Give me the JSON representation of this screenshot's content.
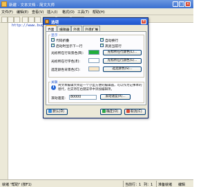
{
  "window": {
    "title": "新建 - 文本文档 - 简文大师",
    "min_glyph": "_",
    "max_glyph": "□",
    "close_glyph": "×"
  },
  "menu": [
    "文件(F)",
    "编辑(E)",
    "查看(V)",
    "插入(I)",
    "格式(O)",
    "工具(T)",
    "帮助(H)"
  ],
  "editor": {
    "first_line": "http://www.buggou.com"
  },
  "status": {
    "left_text": "就绪 \"帮助\" (按F1)",
    "line_text": "当前行：1",
    "col_text": "列：1",
    "mode_text": "准备就绪",
    "ovr_text": "编辑"
  },
  "dialog": {
    "title": "选项",
    "close_glyph": "×",
    "tabs": [
      "界面",
      "编辑器",
      "外观",
      "外观扩展"
    ],
    "display_group": {
      "label": "显示",
      "checks": [
        {
          "label": "代码折叠",
          "checked": true
        },
        {
          "label": "自动换行",
          "checked": true
        },
        {
          "label": "启动时显示下一行",
          "checked": true
        },
        {
          "label": "高亮当前行",
          "checked": true
        }
      ],
      "color_rows": [
        {
          "label": "光标所在行背景色(B):",
          "color": "#1fae3a",
          "button": "光标所在行颜色(L)..."
        },
        {
          "label": "光标所在行字色(E):",
          "color": "#ffffff",
          "button": "光标所在行颜色(S)..."
        },
        {
          "label": "选定颜色背景色(C):",
          "color": "#fbe7c6",
          "button": "选定颜色(S)..."
        }
      ]
    },
    "assoc_group": {
      "label": "关联",
      "info_glyph": "i",
      "description": "简文本编辑大师是一个小型方便的编辑器，可以作为记事本的替代，也支持在右键菜单中添加编辑项。",
      "speed_label": "滚动速度:",
      "speed_value": "80000",
      "speed_button": "滚动速度(R)..."
    },
    "buttons": {
      "default_label": "默认(D)",
      "ok_label": "确定(O)",
      "cancel_label": "取消(C)"
    }
  }
}
